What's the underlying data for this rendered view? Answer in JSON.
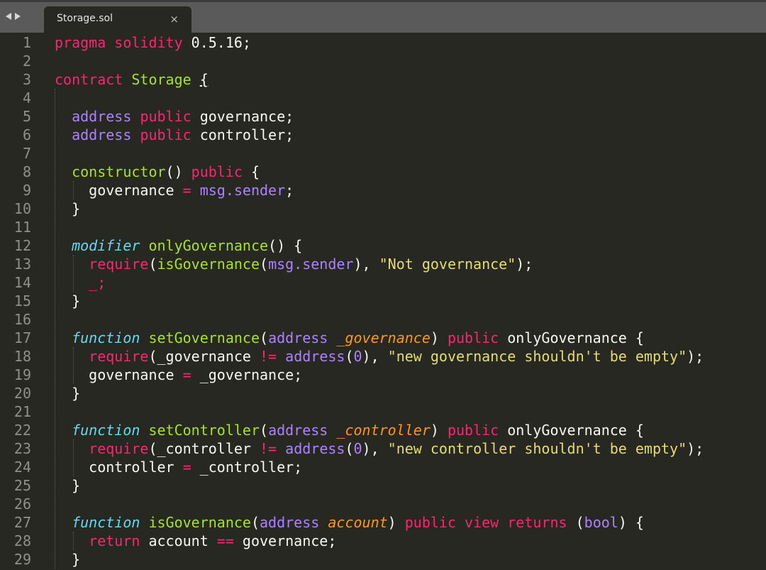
{
  "tabbar": {
    "back_icon": "chevron-left-icon",
    "forward_icon": "chevron-right-icon",
    "tab": {
      "title": "Storage.sol",
      "close_label": "×"
    }
  },
  "colors": {
    "background": "#272822",
    "gutter_text": "#8f908a",
    "keyword": "#f92672",
    "function_name": "#a6e22e",
    "type": "#ae81ff",
    "string": "#e6db74",
    "storage_italic": "#66d9ef",
    "parameter": "#fd971f",
    "plain": "#f8f8f2"
  },
  "editor": {
    "lines": [
      {
        "n": "1",
        "tokens": [
          [
            "kw",
            "pragma"
          ],
          [
            "plain",
            " "
          ],
          [
            "kw",
            "solidity"
          ],
          [
            "plain",
            " 0.5.16;"
          ]
        ]
      },
      {
        "n": "2",
        "tokens": []
      },
      {
        "n": "3",
        "tokens": [
          [
            "kw",
            "contract"
          ],
          [
            "plain",
            " "
          ],
          [
            "fn",
            "Storage"
          ],
          [
            "plain",
            " "
          ],
          [
            "brace",
            "{"
          ]
        ]
      },
      {
        "n": "4",
        "tokens": []
      },
      {
        "n": "5",
        "tokens": [
          [
            "plain",
            "  "
          ],
          [
            "ty",
            "address"
          ],
          [
            "plain",
            " "
          ],
          [
            "kw",
            "public"
          ],
          [
            "plain",
            " governance;"
          ]
        ]
      },
      {
        "n": "6",
        "tokens": [
          [
            "plain",
            "  "
          ],
          [
            "ty",
            "address"
          ],
          [
            "plain",
            " "
          ],
          [
            "kw",
            "public"
          ],
          [
            "plain",
            " controller;"
          ]
        ]
      },
      {
        "n": "7",
        "tokens": []
      },
      {
        "n": "8",
        "tokens": [
          [
            "plain",
            "  "
          ],
          [
            "fn",
            "constructor"
          ],
          [
            "plain",
            "() "
          ],
          [
            "kw",
            "public"
          ],
          [
            "plain",
            " {"
          ]
        ]
      },
      {
        "n": "9",
        "tokens": [
          [
            "plain",
            "    governance "
          ],
          [
            "kw",
            "="
          ],
          [
            "plain",
            " "
          ],
          [
            "ty",
            "msg.sender"
          ],
          [
            "plain",
            ";"
          ]
        ]
      },
      {
        "n": "10",
        "tokens": [
          [
            "plain",
            "  }"
          ]
        ]
      },
      {
        "n": "11",
        "tokens": []
      },
      {
        "n": "12",
        "tokens": [
          [
            "plain",
            "  "
          ],
          [
            "sto",
            "modifier"
          ],
          [
            "plain",
            " "
          ],
          [
            "fn",
            "onlyGovernance"
          ],
          [
            "plain",
            "() {"
          ]
        ]
      },
      {
        "n": "13",
        "tokens": [
          [
            "plain",
            "    "
          ],
          [
            "kw",
            "require"
          ],
          [
            "plain",
            "("
          ],
          [
            "fn",
            "isGovernance"
          ],
          [
            "plain",
            "("
          ],
          [
            "ty",
            "msg.sender"
          ],
          [
            "plain",
            "), "
          ],
          [
            "str",
            "\"Not governance\""
          ],
          [
            "plain",
            ");"
          ]
        ]
      },
      {
        "n": "14",
        "tokens": [
          [
            "plain",
            "    "
          ],
          [
            "kw",
            "_;"
          ]
        ]
      },
      {
        "n": "15",
        "tokens": [
          [
            "plain",
            "  }"
          ]
        ]
      },
      {
        "n": "16",
        "tokens": []
      },
      {
        "n": "17",
        "tokens": [
          [
            "plain",
            "  "
          ],
          [
            "sto",
            "function"
          ],
          [
            "plain",
            " "
          ],
          [
            "fn",
            "setGovernance"
          ],
          [
            "plain",
            "("
          ],
          [
            "ty",
            "address"
          ],
          [
            "plain",
            " "
          ],
          [
            "par",
            "_governance"
          ],
          [
            "plain",
            ") "
          ],
          [
            "kw",
            "public"
          ],
          [
            "plain",
            " onlyGovernance {"
          ]
        ]
      },
      {
        "n": "18",
        "tokens": [
          [
            "plain",
            "    "
          ],
          [
            "kw",
            "require"
          ],
          [
            "plain",
            "(_governance "
          ],
          [
            "kw",
            "!="
          ],
          [
            "plain",
            " "
          ],
          [
            "ty",
            "address"
          ],
          [
            "plain",
            "("
          ],
          [
            "num",
            "0"
          ],
          [
            "plain",
            "), "
          ],
          [
            "str",
            "\"new governance shouldn't be empty\""
          ],
          [
            "plain",
            ");"
          ]
        ]
      },
      {
        "n": "19",
        "tokens": [
          [
            "plain",
            "    governance "
          ],
          [
            "kw",
            "="
          ],
          [
            "plain",
            " _governance;"
          ]
        ]
      },
      {
        "n": "20",
        "tokens": [
          [
            "plain",
            "  }"
          ]
        ]
      },
      {
        "n": "21",
        "tokens": []
      },
      {
        "n": "22",
        "tokens": [
          [
            "plain",
            "  "
          ],
          [
            "sto",
            "function"
          ],
          [
            "plain",
            " "
          ],
          [
            "fn",
            "setController"
          ],
          [
            "plain",
            "("
          ],
          [
            "ty",
            "address"
          ],
          [
            "plain",
            " "
          ],
          [
            "par",
            "_controller"
          ],
          [
            "plain",
            ") "
          ],
          [
            "kw",
            "public"
          ],
          [
            "plain",
            " onlyGovernance {"
          ]
        ]
      },
      {
        "n": "23",
        "tokens": [
          [
            "plain",
            "    "
          ],
          [
            "kw",
            "require"
          ],
          [
            "plain",
            "(_controller "
          ],
          [
            "kw",
            "!="
          ],
          [
            "plain",
            " "
          ],
          [
            "ty",
            "address"
          ],
          [
            "plain",
            "("
          ],
          [
            "num",
            "0"
          ],
          [
            "plain",
            "), "
          ],
          [
            "str",
            "\"new controller shouldn't be empty\""
          ],
          [
            "plain",
            ");"
          ]
        ]
      },
      {
        "n": "24",
        "tokens": [
          [
            "plain",
            "    controller "
          ],
          [
            "kw",
            "="
          ],
          [
            "plain",
            " _controller;"
          ]
        ]
      },
      {
        "n": "25",
        "tokens": [
          [
            "plain",
            "  }"
          ]
        ]
      },
      {
        "n": "26",
        "tokens": []
      },
      {
        "n": "27",
        "tokens": [
          [
            "plain",
            "  "
          ],
          [
            "sto",
            "function"
          ],
          [
            "plain",
            " "
          ],
          [
            "fn",
            "isGovernance"
          ],
          [
            "plain",
            "("
          ],
          [
            "ty",
            "address"
          ],
          [
            "plain",
            " "
          ],
          [
            "par",
            "account"
          ],
          [
            "plain",
            ") "
          ],
          [
            "kw",
            "public"
          ],
          [
            "plain",
            " "
          ],
          [
            "kw",
            "view"
          ],
          [
            "plain",
            " "
          ],
          [
            "kw",
            "returns"
          ],
          [
            "plain",
            " ("
          ],
          [
            "ty",
            "bool"
          ],
          [
            "plain",
            ") {"
          ]
        ]
      },
      {
        "n": "28",
        "tokens": [
          [
            "plain",
            "    "
          ],
          [
            "kw",
            "return"
          ],
          [
            "plain",
            " account "
          ],
          [
            "kw",
            "=="
          ],
          [
            "plain",
            " governance;"
          ]
        ]
      },
      {
        "n": "29",
        "tokens": [
          [
            "plain",
            "  }"
          ]
        ]
      }
    ]
  }
}
